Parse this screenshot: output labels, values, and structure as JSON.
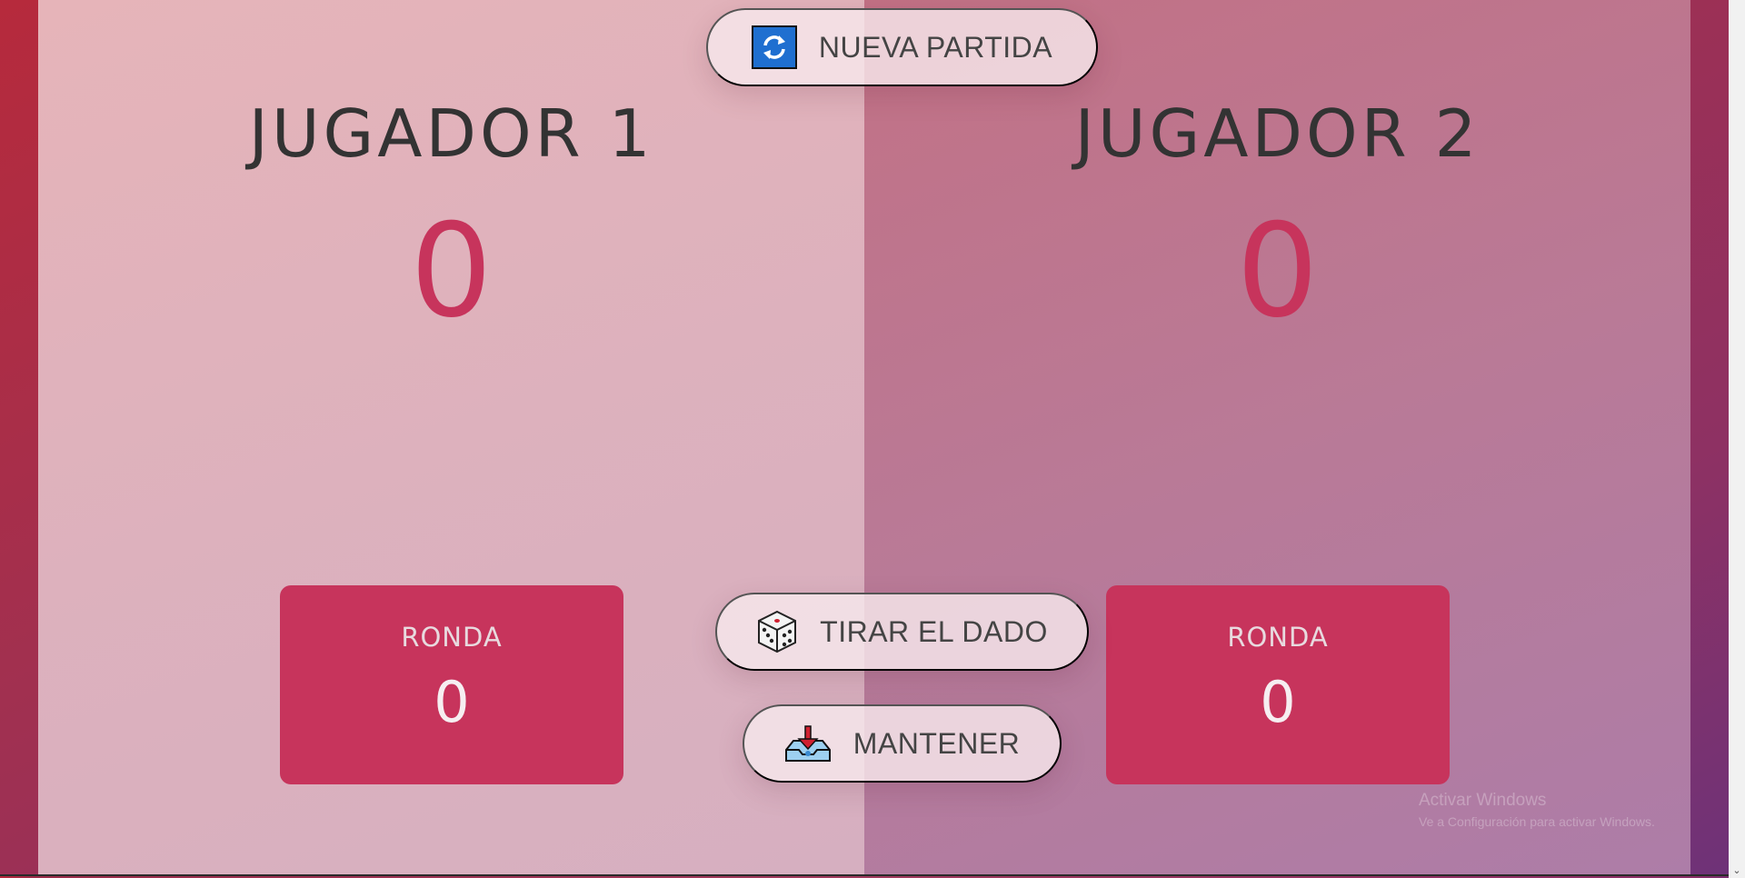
{
  "header": {
    "new_game_label": "NUEVA PARTIDA",
    "new_game_icon": "refresh-icon"
  },
  "players": [
    {
      "name": "JUGADOR 1",
      "score": "0",
      "round_label": "RONDA",
      "round_value": "0"
    },
    {
      "name": "JUGADOR 2",
      "score": "0",
      "round_label": "RONDA",
      "round_value": "0"
    }
  ],
  "controls": {
    "roll_label": "TIRAR EL DADO",
    "roll_icon": "dice-icon",
    "hold_label": "MANTENER",
    "hold_icon": "inbox-tray-icon"
  },
  "watermark": {
    "title": "Activar Windows",
    "subtitle": "Ve a Configuración para activar Windows."
  },
  "colors": {
    "accent": "#c7345c",
    "player1_bg": "#e0b3bc",
    "player2_bg": "#b97a97",
    "button_bg": "#f6e8ec"
  }
}
